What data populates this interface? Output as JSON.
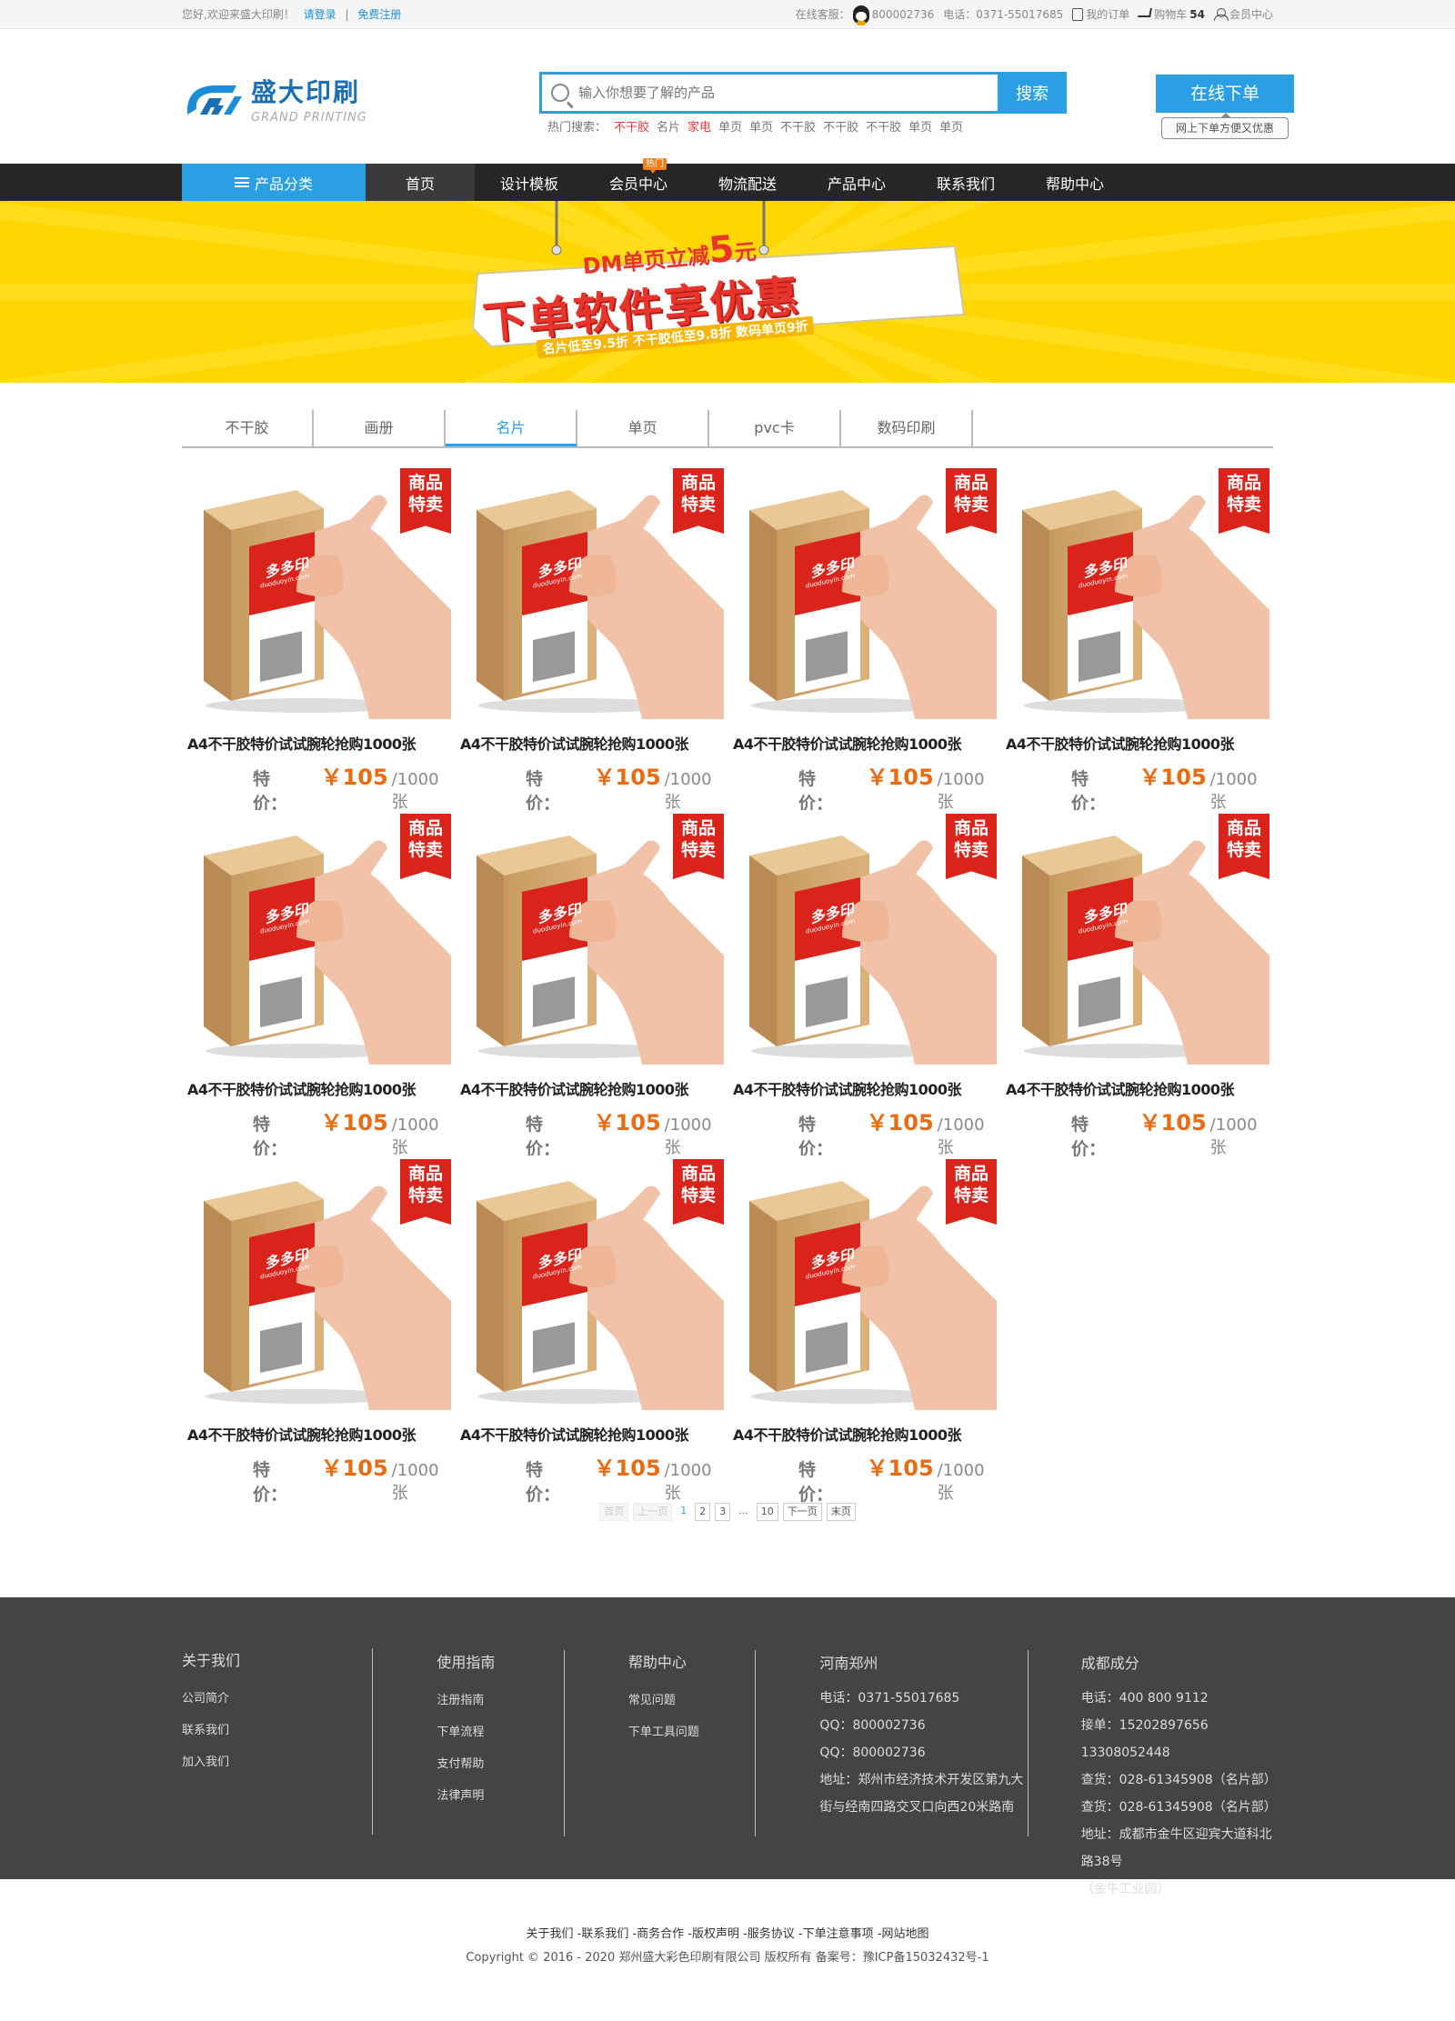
{
  "topbar": {
    "welcome": "您好,欢迎来盛大印刷！",
    "login": "请登录",
    "sep": "|",
    "register": "免费注册",
    "service_label": "在线客服：",
    "service_qq": "800002736",
    "phone": "电话：0371-55017685",
    "my_orders": "我的订单",
    "cart_label": "购物车",
    "cart_count": "54",
    "member_center": "会员中心"
  },
  "logo": {
    "cn": "盛大印刷",
    "en": "GRAND PRINTING"
  },
  "search": {
    "placeholder": "输入你想要了解的产品",
    "button": "搜索",
    "hot_label": "热门搜索：",
    "hot": [
      "不干胶",
      "名片",
      "家电",
      "单页",
      "单页",
      "不干胶",
      "不干胶",
      "不干胶",
      "单页",
      "单页"
    ],
    "hot_red": [
      true,
      false,
      true,
      false,
      false,
      false,
      false,
      false,
      false,
      false
    ]
  },
  "order": {
    "button": "在线下单",
    "tip": "网上下单方便又优惠"
  },
  "nav": {
    "category": "产品分类",
    "items": [
      "首页",
      "设计模板",
      "会员中心",
      "物流配送",
      "产品中心",
      "联系我们",
      "帮助中心"
    ],
    "hot_badge": "热门"
  },
  "banner": {
    "line1_pre": "DM单页立减",
    "line1_num": "5",
    "line1_unit": "元",
    "line2": "下单软件享优惠",
    "line3": "名片低至9.5折  不干胶低至9.8折  数码单页9折"
  },
  "tabs": [
    "不干胶",
    "画册",
    "名片",
    "单页",
    "pvc卡",
    "数码印刷"
  ],
  "active_tab": 2,
  "products": [
    {
      "title": "A4不干胶特价试试腕轮抢购1000张",
      "price_label": "特价：",
      "price": "￥105",
      "unit": "/1000张",
      "ribbon": [
        "商品",
        "特卖"
      ],
      "box_brand": "多多印",
      "box_sub": "duoduoyin.com"
    },
    {
      "title": "A4不干胶特价试试腕轮抢购1000张",
      "price_label": "特价：",
      "price": "￥105",
      "unit": "/1000张",
      "ribbon": [
        "商品",
        "特卖"
      ],
      "box_brand": "多多印",
      "box_sub": "duoduoyin.com"
    },
    {
      "title": "A4不干胶特价试试腕轮抢购1000张",
      "price_label": "特价：",
      "price": "￥105",
      "unit": "/1000张",
      "ribbon": [
        "商品",
        "特卖"
      ],
      "box_brand": "多多印",
      "box_sub": "duoduoyin.com"
    },
    {
      "title": "A4不干胶特价试试腕轮抢购1000张",
      "price_label": "特价：",
      "price": "￥105",
      "unit": "/1000张",
      "ribbon": [
        "商品",
        "特卖"
      ],
      "box_brand": "多多印",
      "box_sub": "duoduoyin.com"
    },
    {
      "title": "A4不干胶特价试试腕轮抢购1000张",
      "price_label": "特价：",
      "price": "￥105",
      "unit": "/1000张",
      "ribbon": [
        "商品",
        "特卖"
      ],
      "box_brand": "多多印",
      "box_sub": "duoduoyin.com"
    },
    {
      "title": "A4不干胶特价试试腕轮抢购1000张",
      "price_label": "特价：",
      "price": "￥105",
      "unit": "/1000张",
      "ribbon": [
        "商品",
        "特卖"
      ],
      "box_brand": "多多印",
      "box_sub": "duoduoyin.com"
    },
    {
      "title": "A4不干胶特价试试腕轮抢购1000张",
      "price_label": "特价：",
      "price": "￥105",
      "unit": "/1000张",
      "ribbon": [
        "商品",
        "特卖"
      ],
      "box_brand": "多多印",
      "box_sub": "duoduoyin.com"
    },
    {
      "title": "A4不干胶特价试试腕轮抢购1000张",
      "price_label": "特价：",
      "price": "￥105",
      "unit": "/1000张",
      "ribbon": [
        "商品",
        "特卖"
      ],
      "box_brand": "多多印",
      "box_sub": "duoduoyin.com"
    },
    {
      "title": "A4不干胶特价试试腕轮抢购1000张",
      "price_label": "特价：",
      "price": "￥105",
      "unit": "/1000张",
      "ribbon": [
        "商品",
        "特卖"
      ],
      "box_brand": "多多印",
      "box_sub": "duoduoyin.com"
    },
    {
      "title": "A4不干胶特价试试腕轮抢购1000张",
      "price_label": "特价：",
      "price": "￥105",
      "unit": "/1000张",
      "ribbon": [
        "商品",
        "特卖"
      ],
      "box_brand": "多多印",
      "box_sub": "duoduoyin.com"
    },
    {
      "title": "A4不干胶特价试试腕轮抢购1000张",
      "price_label": "特价：",
      "price": "￥105",
      "unit": "/1000张",
      "ribbon": [
        "商品",
        "特卖"
      ],
      "box_brand": "多多印",
      "box_sub": "duoduoyin.com"
    }
  ],
  "pager": {
    "first": "首页",
    "prev": "上一页",
    "pages": [
      "1",
      "2",
      "3"
    ],
    "dots": "...",
    "last_page": "10",
    "next": "下一页",
    "end": "末页",
    "current": "1"
  },
  "footer": {
    "about": {
      "title": "关于我们",
      "items": [
        "公司简介",
        "联系我们",
        "加入我们"
      ]
    },
    "guide": {
      "title": "使用指南",
      "items": [
        "注册指南",
        "下单流程",
        "支付帮助",
        "法律声明"
      ]
    },
    "help": {
      "title": "帮助中心",
      "items": [
        "常见问题",
        "下单工具问题"
      ]
    },
    "zhengzhou": {
      "title": "河南郑州",
      "items": [
        "电话：0371-55017685",
        "QQ：800002736",
        "QQ：800002736",
        "地址：郑州市经济技术开发区第九大",
        "街与经南四路交叉口向西20米路南"
      ]
    },
    "chengdu": {
      "title": "成都成分",
      "items": [
        "电话：400 800 9112",
        "接单：15202897656 13308052448",
        "查货：028-61345908（名片部）",
        "查货：028-61345908（名片部）",
        "地址：成都市金牛区迎宾大道科北路38号",
        "（金牛工业园）"
      ]
    }
  },
  "bottom": {
    "links": "关于我们 -联系我们 -商务合作 -版权声明 -服务协议 -下单注意事项 -网站地图",
    "copyright": "Copyright © 2016 - 2020 郑州盛大彩色印刷有限公司 版权所有 备案号：豫ICP备15032432号-1"
  },
  "colors": {
    "accent": "#2a9fe4",
    "price": "#e96b12",
    "banner_bg": "#ffd600",
    "nav_bg": "#262626",
    "footer_bg": "#444444"
  }
}
